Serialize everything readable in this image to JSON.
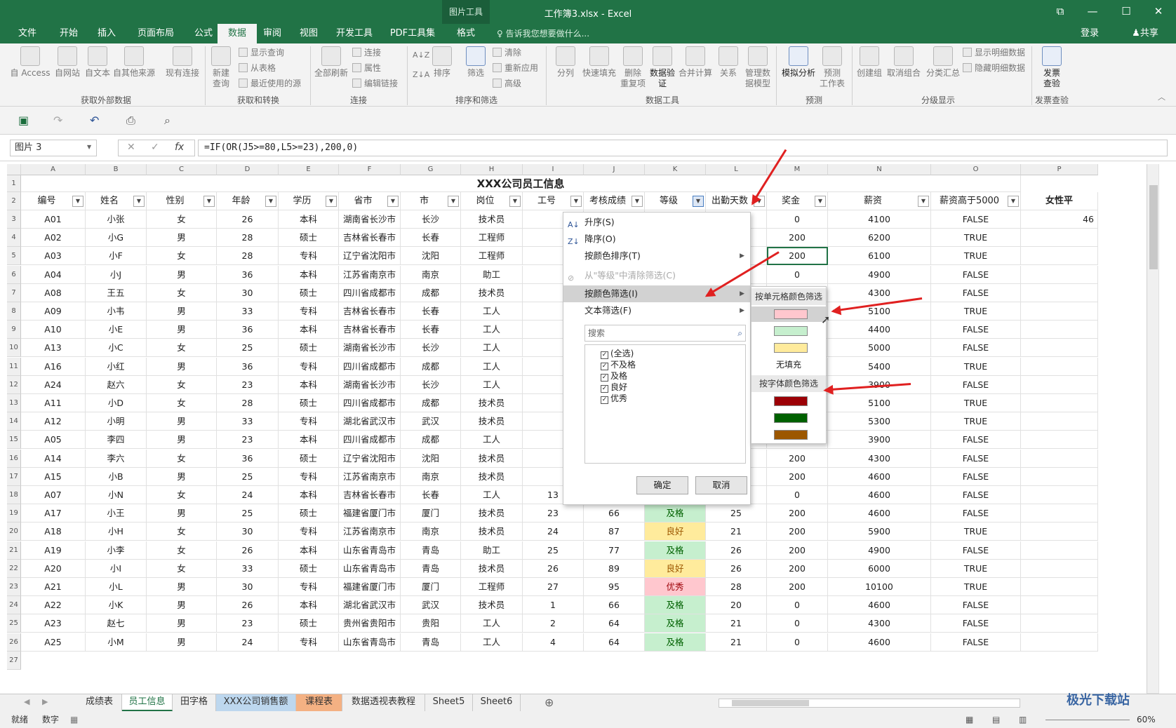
{
  "titlebar": {
    "title": "工作簿3.xlsx - Excel",
    "context_tool": "图片工具",
    "restore": "⧉",
    "minimize": "—",
    "maximize": "☐",
    "close": "✕"
  },
  "tabs": [
    "文件",
    "开始",
    "插入",
    "页面布局",
    "公式",
    "数据",
    "审阅",
    "视图",
    "开发工具",
    "PDF工具集",
    "格式"
  ],
  "tell_me": "告诉我您想要做什么...",
  "account": {
    "login": "登录",
    "share": "共享"
  },
  "ribbon": {
    "ext": [
      "自 Access",
      "自网站",
      "自文本",
      "自其他来源",
      "现有连接"
    ],
    "new_query": "新建\n查询",
    "get_transform": [
      "显示查询",
      "从表格",
      "最近使用的源"
    ],
    "refresh_all": "全部刷新",
    "connections": [
      "连接",
      "属性",
      "编辑链接"
    ],
    "sort": "排序",
    "filter": "筛选",
    "filter_small": [
      "清除",
      "重新应用",
      "高级"
    ],
    "tools": [
      "分列",
      "快速填充",
      "删除\n重复项",
      "数据验\n证",
      "合并计算",
      "关系",
      "管理数\n据模型"
    ],
    "forecast": [
      "模拟分析",
      "预测\n工作表"
    ],
    "outline": [
      "创建组",
      "取消组合",
      "分类汇总"
    ],
    "outline_small": [
      "显示明细数据",
      "隐藏明细数据"
    ],
    "invoice": "发票\n查验",
    "groups": [
      "获取外部数据",
      "获取和转换",
      "连接",
      "排序和筛选",
      "数据工具",
      "预测",
      "分级显示",
      "发票查验"
    ]
  },
  "namebox": "图片 3",
  "formula": "=IF(OR(J5>=80,L5>=23),200,0)",
  "sheet": {
    "title": "XXX公司员工信息",
    "col_letters": [
      "A",
      "B",
      "C",
      "D",
      "E",
      "F",
      "G",
      "H",
      "I",
      "J",
      "K",
      "L",
      "M",
      "N",
      "O",
      "P"
    ],
    "headers": [
      "编号",
      "姓名",
      "性别",
      "年龄",
      "学历",
      "省市",
      "市",
      "岗位",
      "工号",
      "考核成绩",
      "等级",
      "出勤天数",
      "奖金",
      "薪资",
      "薪资高于5000",
      "女性平"
    ],
    "p3": "46",
    "rows": [
      [
        "A01",
        "小张",
        "女",
        "26",
        "本科",
        "湖南省长沙市",
        "长沙",
        "技术员",
        "",
        "",
        "",
        "21",
        "0",
        "4100",
        "FALSE"
      ],
      [
        "A02",
        "小G",
        "男",
        "28",
        "硕士",
        "吉林省长春市",
        "长春",
        "工程师",
        "",
        "",
        "",
        "21",
        "200",
        "6200",
        "TRUE"
      ],
      [
        "A03",
        "小F",
        "女",
        "28",
        "专科",
        "辽宁省沈阳市",
        "沈阳",
        "工程师",
        "",
        "",
        "",
        "21",
        "200",
        "6100",
        "TRUE"
      ],
      [
        "A04",
        "小J",
        "男",
        "36",
        "本科",
        "江苏省南京市",
        "南京",
        "助工",
        "",
        "",
        "",
        "21",
        "0",
        "4900",
        "FALSE"
      ],
      [
        "A08",
        "王五",
        "女",
        "30",
        "硕士",
        "四川省成都市",
        "成都",
        "技术员",
        "",
        "",
        "",
        "",
        "0",
        "4300",
        "FALSE"
      ],
      [
        "A09",
        "小韦",
        "男",
        "33",
        "专科",
        "吉林省长春市",
        "长春",
        "工人",
        "",
        "",
        "",
        "",
        "200",
        "5100",
        "TRUE"
      ],
      [
        "A10",
        "小E",
        "男",
        "36",
        "本科",
        "吉林省长春市",
        "长春",
        "工人",
        "",
        "",
        "",
        "",
        "0",
        "4400",
        "FALSE"
      ],
      [
        "A13",
        "小C",
        "女",
        "25",
        "硕士",
        "湖南省长沙市",
        "长沙",
        "工人",
        "",
        "",
        "",
        "",
        "200",
        "5000",
        "FALSE"
      ],
      [
        "A16",
        "小红",
        "男",
        "36",
        "专科",
        "四川省成都市",
        "成都",
        "工人",
        "",
        "",
        "",
        "",
        "200",
        "5400",
        "TRUE"
      ],
      [
        "A24",
        "赵六",
        "女",
        "23",
        "本科",
        "湖南省长沙市",
        "长沙",
        "工人",
        "",
        "",
        "",
        "",
        "0",
        "3900",
        "FALSE"
      ],
      [
        "A11",
        "小D",
        "女",
        "28",
        "硕士",
        "四川省成都市",
        "成都",
        "技术员",
        "",
        "",
        "",
        "",
        "200",
        "5100",
        "TRUE"
      ],
      [
        "A12",
        "小明",
        "男",
        "33",
        "专科",
        "湖北省武汉市",
        "武汉",
        "技术员",
        "",
        "",
        "",
        "",
        "200",
        "5300",
        "TRUE"
      ],
      [
        "A05",
        "李四",
        "男",
        "23",
        "本科",
        "四川省成都市",
        "成都",
        "工人",
        "",
        "",
        "",
        "22",
        "0",
        "3900",
        "FALSE"
      ],
      [
        "A14",
        "李六",
        "女",
        "36",
        "硕士",
        "辽宁省沈阳市",
        "沈阳",
        "技术员",
        "",
        "",
        "",
        "23",
        "200",
        "4300",
        "FALSE"
      ],
      [
        "A15",
        "小B",
        "男",
        "25",
        "专科",
        "江苏省南京市",
        "南京",
        "技术员",
        "",
        "",
        "",
        "24",
        "200",
        "4600",
        "FALSE"
      ],
      [
        "A07",
        "小N",
        "女",
        "24",
        "本科",
        "吉林省长春市",
        "长春",
        "工人",
        "13",
        "65",
        "及格",
        "22",
        "0",
        "4600",
        "FALSE"
      ],
      [
        "A17",
        "小王",
        "男",
        "25",
        "硕士",
        "福建省厦门市",
        "厦门",
        "技术员",
        "23",
        "66",
        "及格",
        "25",
        "200",
        "4600",
        "FALSE"
      ],
      [
        "A18",
        "小H",
        "女",
        "30",
        "专科",
        "江苏省南京市",
        "南京",
        "技术员",
        "24",
        "87",
        "良好",
        "21",
        "200",
        "5900",
        "TRUE"
      ],
      [
        "A19",
        "小李",
        "女",
        "26",
        "本科",
        "山东省青岛市",
        "青岛",
        "助工",
        "25",
        "77",
        "及格",
        "26",
        "200",
        "4900",
        "FALSE"
      ],
      [
        "A20",
        "小I",
        "女",
        "33",
        "硕士",
        "山东省青岛市",
        "青岛",
        "技术员",
        "26",
        "89",
        "良好",
        "26",
        "200",
        "6000",
        "TRUE"
      ],
      [
        "A21",
        "小L",
        "男",
        "30",
        "专科",
        "福建省厦门市",
        "厦门",
        "工程师",
        "27",
        "95",
        "优秀",
        "28",
        "200",
        "10100",
        "TRUE"
      ],
      [
        "A22",
        "小K",
        "男",
        "26",
        "本科",
        "湖北省武汉市",
        "武汉",
        "技术员",
        "1",
        "66",
        "及格",
        "20",
        "0",
        "4600",
        "FALSE"
      ],
      [
        "A23",
        "赵七",
        "男",
        "23",
        "硕士",
        "贵州省贵阳市",
        "贵阳",
        "工人",
        "2",
        "64",
        "及格",
        "21",
        "0",
        "4300",
        "FALSE"
      ],
      [
        "A25",
        "小M",
        "男",
        "24",
        "专科",
        "山东省青岛市",
        "青岛",
        "工人",
        "4",
        "64",
        "及格",
        "21",
        "0",
        "4600",
        "FALSE"
      ]
    ]
  },
  "filter_menu": {
    "items": [
      "升序(S)",
      "降序(O)",
      "按颜色排序(T)",
      "从\"等级\"中清除筛选(C)",
      "按颜色筛选(I)",
      "文本筛选(F)"
    ],
    "search_placeholder": "搜索",
    "checklist": [
      "(全选)",
      "不及格",
      "及格",
      "良好",
      "优秀"
    ],
    "ok": "确定",
    "cancel": "取消"
  },
  "color_submenu": {
    "cell_color_title": "按单元格颜色筛选",
    "no_fill": "无填充",
    "font_color_title": "按字体颜色筛选",
    "cell_colors": [
      "#ffc7ce",
      "#c6efce",
      "#ffeb9c"
    ],
    "font_colors": [
      "#9c0006",
      "#006100",
      "#9c5700"
    ]
  },
  "sheet_tabs": [
    "成绩表",
    "员工信息",
    "田字格",
    "XXX公司销售额",
    "课程表",
    "数据透视表教程",
    "Sheet5",
    "Sheet6"
  ],
  "status": {
    "ready": "就绪",
    "mode": "数字",
    "zoom": "60%"
  },
  "watermark": "极光下载站"
}
